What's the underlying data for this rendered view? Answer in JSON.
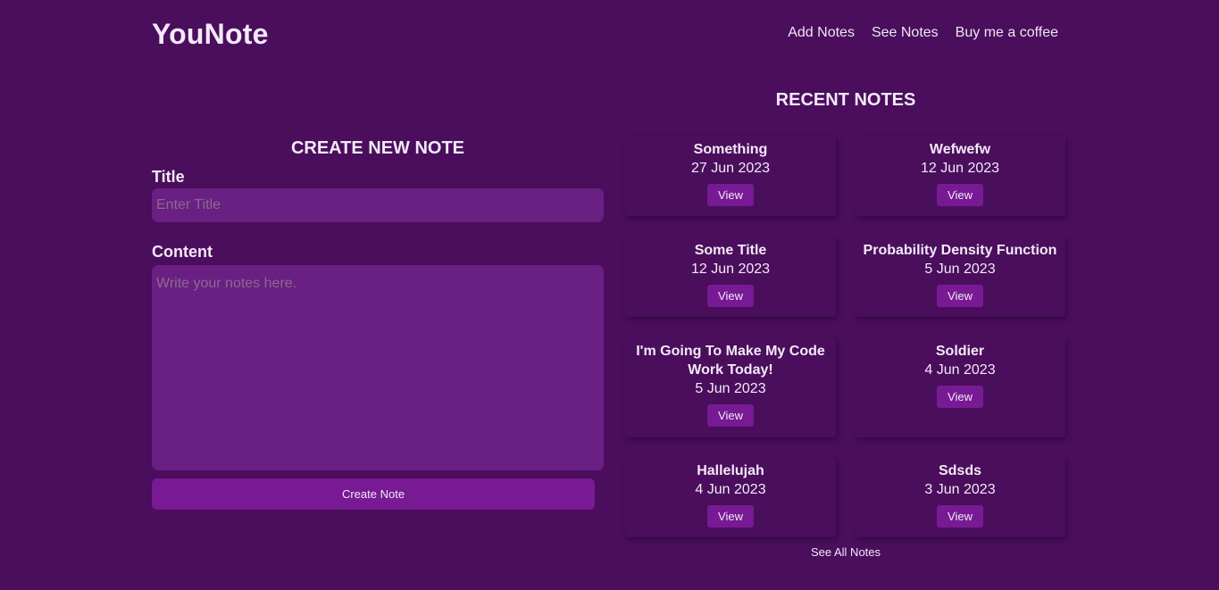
{
  "header": {
    "logo": "YouNote",
    "nav": [
      "Add Notes",
      "See Notes",
      "Buy me a coffee"
    ]
  },
  "create": {
    "heading": "CREATE NEW NOTE",
    "title_label": "Title",
    "title_placeholder": "Enter Title",
    "content_label": "Content",
    "content_placeholder": "Write your notes here.",
    "button": "Create Note"
  },
  "recent": {
    "heading": "RECENT NOTES",
    "notes": [
      {
        "title": "Something",
        "date": "27 Jun 2023",
        "action": "View"
      },
      {
        "title": "Wefwefw",
        "date": "12 Jun 2023",
        "action": "View"
      },
      {
        "title": "Some Title",
        "date": "12 Jun 2023",
        "action": "View"
      },
      {
        "title": "Probability Density Function",
        "date": "5 Jun 2023",
        "action": "View"
      },
      {
        "title": "I'm Going To Make My Code Work Today!",
        "date": "5 Jun 2023",
        "action": "View"
      },
      {
        "title": "Soldier",
        "date": "4 Jun 2023",
        "action": "View"
      },
      {
        "title": "Hallelujah",
        "date": "4 Jun 2023",
        "action": "View"
      },
      {
        "title": "Sdsds",
        "date": "3 Jun 2023",
        "action": "View"
      }
    ],
    "see_all": "See All Notes"
  },
  "colors": {
    "background": "#4a0e5c",
    "input_bg": "#6a1f82",
    "button_bg": "#771a94",
    "text": "#f3e9f7"
  }
}
